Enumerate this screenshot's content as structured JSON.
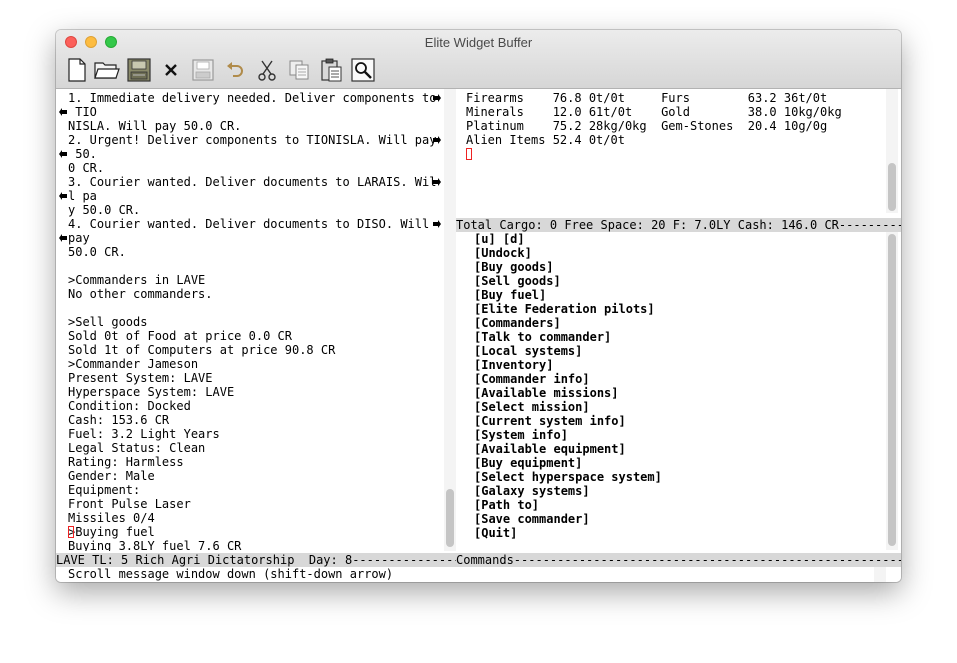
{
  "window": {
    "title": "Elite Widget Buffer"
  },
  "toolbar": {
    "icons": [
      "new-file-icon",
      "open-folder-icon",
      "save-icon",
      "close-icon",
      "save-disabled-icon",
      "undo-icon",
      "cut-icon",
      "copy-icon",
      "paste-icon",
      "find-icon"
    ]
  },
  "messages": {
    "lines": [
      "1. Immediate delivery needed. Deliver components to",
      " TIO",
      "NISLA. Will pay 50.0 CR.",
      "2. Urgent! Deliver components to TIONISLA. Will pay",
      " 50.",
      "0 CR.",
      "3. Courier wanted. Deliver documents to LARAIS. Wil",
      "l pa",
      "y 50.0 CR.",
      "4. Courier wanted. Deliver documents to DISO. Will",
      "pay",
      "50.0 CR.",
      "",
      ">Commanders in LAVE",
      "No other commanders.",
      "",
      ">Sell goods",
      "Sold 0t of Food at price 0.0 CR",
      "Sold 1t of Computers at price 90.8 CR",
      ">Commander Jameson",
      "Present System: LAVE",
      "Hyperspace System: LAVE",
      "Condition: Docked",
      "Cash: 153.6 CR",
      "Fuel: 3.2 Light Years",
      "Legal Status: Clean",
      "Rating: Harmless",
      "Gender: Male",
      "Equipment:",
      "Front Pulse Laser",
      "Missiles 0/4",
      ">Buying fuel",
      "Buying 3.8LY fuel 7.6 CR"
    ]
  },
  "cargo": {
    "rows": [
      "Firearms    76.8 0t/0t     Furs        63.2 36t/0t",
      "Minerals    12.0 61t/0t    Gold        38.0 10kg/0kg",
      "Platinum    75.2 28kg/0kg  Gem-Stones  20.4 10g/0g",
      "Alien Items 52.4 0t/0t"
    ]
  },
  "status_bar": {
    "cargo_info": "Total Cargo: 0 Free Space: 20 F: 7.0LY Cash: 146.0 CR-----------",
    "location": "LAVE TL: 5 Rich Agri Dictatorship  Day: 8---------------",
    "commands_label": "Commands-------------------------------------------------------"
  },
  "commands": {
    "items": [
      "[u] [d]",
      "[Undock]",
      "[Buy goods]",
      "[Sell goods]",
      "[Buy fuel]",
      "[Elite Federation pilots]",
      "[Commanders]",
      "[Talk to commander]",
      "[Local systems]",
      "[Inventory]",
      "[Commander info]",
      "[Available missions]",
      "[Select mission]",
      "[Current system info]",
      "[System info]",
      "[Available equipment]",
      "[Buy equipment]",
      "[Select hyperspace system]",
      "[Galaxy systems]",
      "[Path to]",
      "[Save commander]",
      "[Quit]"
    ]
  },
  "echo_area": {
    "text": "Scroll message window down (shift-down arrow)"
  }
}
